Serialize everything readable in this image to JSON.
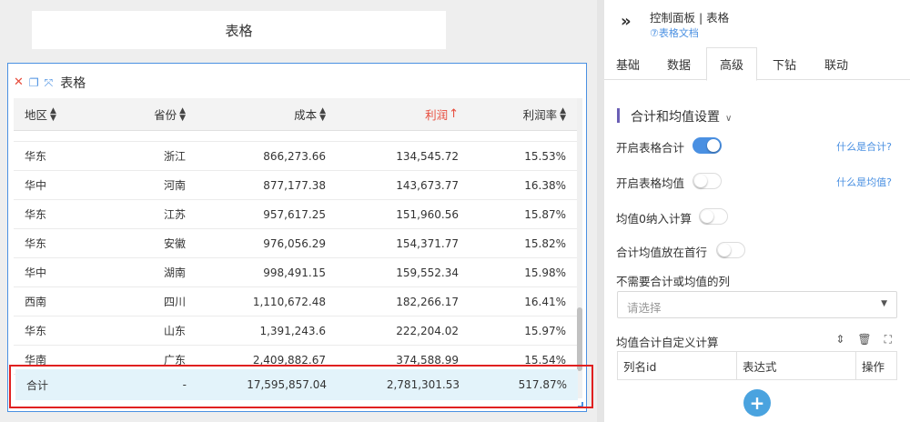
{
  "canvas": {
    "title_card": "表格",
    "widget": {
      "title": "表格",
      "columns": [
        "地区",
        "省份",
        "成本",
        "利润",
        "利润率"
      ],
      "rows": [
        [
          "华东",
          "浙江",
          "866,273.66",
          "134,545.72",
          "15.53%"
        ],
        [
          "华中",
          "河南",
          "877,177.38",
          "143,673.77",
          "16.38%"
        ],
        [
          "华东",
          "江苏",
          "957,617.25",
          "151,960.56",
          "15.87%"
        ],
        [
          "华东",
          "安徽",
          "976,056.29",
          "154,371.77",
          "15.82%"
        ],
        [
          "华中",
          "湖南",
          "998,491.15",
          "159,552.34",
          "15.98%"
        ],
        [
          "西南",
          "四川",
          "1,110,672.48",
          "182,266.17",
          "16.41%"
        ],
        [
          "华东",
          "山东",
          "1,391,243.6",
          "222,204.02",
          "15.97%"
        ],
        [
          "华南",
          "广东",
          "2,409,882.67",
          "374,588.99",
          "15.54%"
        ]
      ],
      "total": [
        "合计",
        "-",
        "17,595,857.04",
        "2,781,301.53",
        "517.87%"
      ]
    }
  },
  "panel": {
    "title": "控制面板 | 表格",
    "doc_link": "⑦表格文档",
    "tabs": [
      "基础",
      "数据",
      "高级",
      "下钻",
      "联动"
    ],
    "active_tab": "高级",
    "section_title": "合计和均值设置",
    "options": {
      "enable_total": {
        "label": "开启表格合计",
        "on": true,
        "help": "什么是合计?"
      },
      "enable_avg": {
        "label": "开启表格均值",
        "on": false,
        "help": "什么是均值?"
      },
      "avg_zero": {
        "label": "均值0纳入计算",
        "on": false
      },
      "total_first": {
        "label": "合计均值放在首行",
        "on": false
      }
    },
    "exclude_label": "不需要合计或均值的列",
    "exclude_placeholder": "请选择",
    "custom_label": "均值合计自定义计算",
    "custom_table_headers": [
      "列名id",
      "表达式",
      "操作"
    ],
    "add_symbol": "+"
  }
}
